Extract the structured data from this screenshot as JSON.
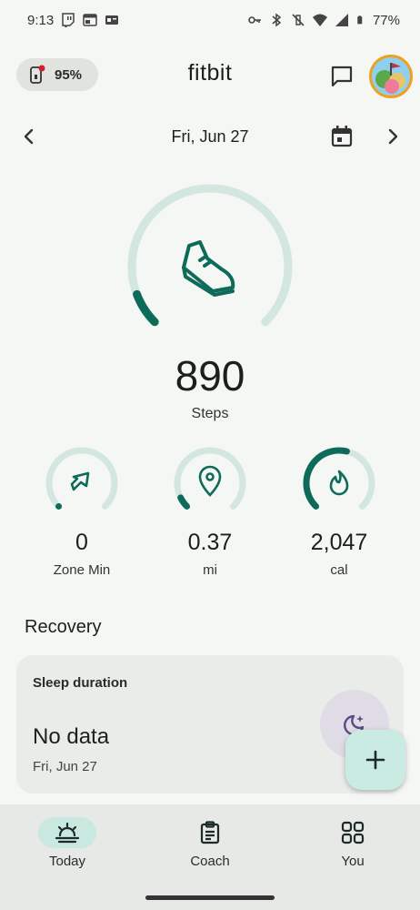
{
  "status_bar": {
    "time": "9:13",
    "battery_percent": "77%"
  },
  "header": {
    "device_battery": "95%",
    "title": "fitbit"
  },
  "date_nav": {
    "label": "Fri, Jun 27"
  },
  "steps": {
    "value": "890",
    "label": "Steps",
    "progress": 0.09
  },
  "stats": [
    {
      "value": "0",
      "label": "Zone Min",
      "progress": 0.0
    },
    {
      "value": "0.37",
      "label": "mi",
      "progress": 0.07
    },
    {
      "value": "2,047",
      "label": "cal",
      "progress": 0.55
    }
  ],
  "recovery": {
    "section_title": "Recovery",
    "sleep_card": {
      "title": "Sleep duration",
      "value": "No data",
      "date": "Fri, Jun 27"
    }
  },
  "bottom_nav": {
    "items": [
      {
        "label": "Today",
        "active": true
      },
      {
        "label": "Coach",
        "active": false
      },
      {
        "label": "You",
        "active": false
      }
    ]
  },
  "colors": {
    "accent": "#0e6b5a",
    "ring_track": "#d3e6df",
    "background": "#f4f7f3"
  }
}
